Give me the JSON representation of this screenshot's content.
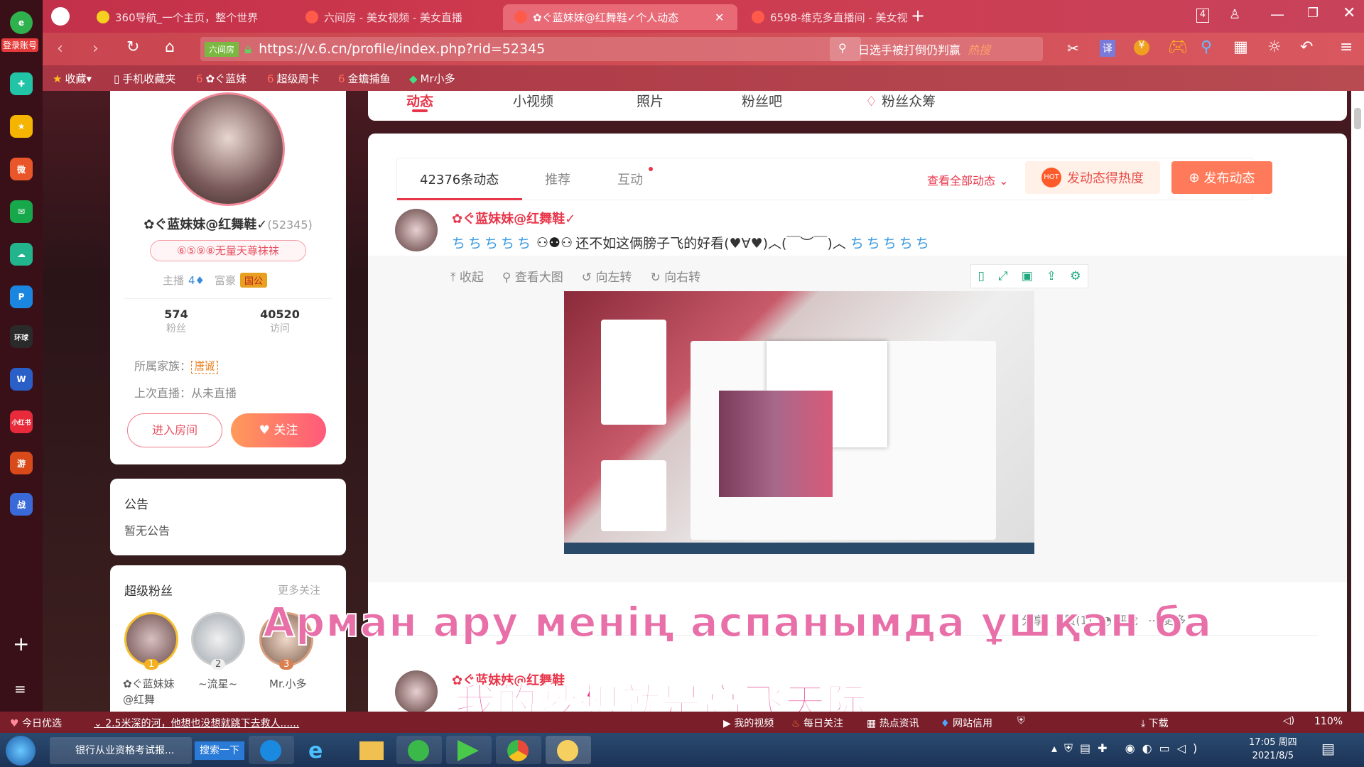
{
  "sidebar": {
    "login_label": "登录账号",
    "items": [
      "add-icon",
      "menu-icon"
    ]
  },
  "tabs": [
    {
      "label": "360导航_一个主页，整个世界",
      "active": false
    },
    {
      "label": "六间房 - 美女视频 - 美女直播",
      "active": false
    },
    {
      "label": "✿ぐ蓝妹妹@红舞鞋✓个人动态",
      "active": true
    },
    {
      "label": "6598-维克多直播间 - 美女视",
      "active": false
    }
  ],
  "tab_count": "4",
  "address": {
    "badge": "六间房",
    "url": "https://v.6.cn/profile/index.php?rid=52345"
  },
  "search": {
    "text": "日选手被打倒仍判赢",
    "hot": "热搜"
  },
  "favorites": [
    {
      "label": "收藏"
    },
    {
      "label": "手机收藏夹"
    },
    {
      "label": "✿ぐ蓝妹"
    },
    {
      "label": "超级周卡"
    },
    {
      "label": "金蟾捕鱼"
    },
    {
      "label": "Mr小多"
    }
  ],
  "nav": {
    "tabs": [
      "动态",
      "小视频",
      "照片",
      "粉丝吧",
      "粉丝众筹"
    ]
  },
  "profile": {
    "name": "✿ぐ蓝妹妹@红舞鞋✓",
    "rid": "(52345)",
    "badge": "⑥⑤⑨⑧无量天尊袜袜",
    "host_label": "主播",
    "rich_label": "富豪",
    "rich_badge": "国公",
    "fans": "574",
    "fans_label": "粉丝",
    "visits": "40520",
    "visits_label": "访问",
    "family_label": "所属家族：",
    "family": "唐诚",
    "last_live": "上次直播：从未直播",
    "enter_room": "进入房间",
    "follow": "关注"
  },
  "notice": {
    "title": "公告",
    "text": "暂无公告"
  },
  "superfans": {
    "title": "超级粉丝",
    "more": "更多关注",
    "fans": [
      {
        "rank": "1",
        "name": "✿ぐ蓝妹妹@红舞"
      },
      {
        "rank": "2",
        "name": "~流星~"
      },
      {
        "rank": "3",
        "name": "Mr.小多"
      }
    ]
  },
  "feed": {
    "tabs": [
      "42376条动态",
      "推荐",
      "互动"
    ],
    "view_all": "查看全部动态",
    "heat_btn": "发动态得热度",
    "post_btn": "发布动态",
    "post": {
      "author": "✿ぐ蓝妹妹@红舞鞋✓",
      "text": "还不如这俩膀子飞的好看(♥∀♥)︿(￣︶￣)︿"
    },
    "image_tools": [
      "收起",
      "查看大图",
      "向左转",
      "向右转"
    ],
    "actions": [
      "分享",
      "赞(1)",
      "评论",
      "更多"
    ],
    "post2_author": "✿ぐ蓝妹妹@红舞鞋"
  },
  "overlay": {
    "line1": "Арман ару менің аспанымда ұшқан ба",
    "line2": "我的梦想就是高飞天际"
  },
  "bottom": {
    "today": "今日优选",
    "news": "2.5米深的河，他想也没想就跳下去救人......",
    "items": [
      "我的视频",
      "每日关注",
      "热点资讯",
      "网站信用"
    ],
    "download": "下载",
    "zoom": "110%"
  },
  "taskbar": {
    "app_label": "银行从业资格考试报...",
    "search_btn": "搜索一下",
    "time": "17:05 周四",
    "date": "2021/8/5"
  }
}
